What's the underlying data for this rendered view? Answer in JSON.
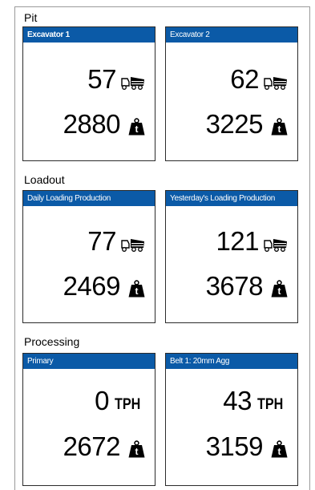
{
  "sections": [
    {
      "title": "Pit",
      "cards": [
        {
          "title": "Excavator 1",
          "bold": true,
          "metric1": {
            "value": "57",
            "icon": "haul-truck-icon"
          },
          "metric2": {
            "value": "2880",
            "icon": "tonne-weight-icon",
            "glyph": "t"
          }
        },
        {
          "title": "Excavator 2",
          "bold": false,
          "metric1": {
            "value": "62",
            "icon": "haul-truck-icon"
          },
          "metric2": {
            "value": "3225",
            "icon": "tonne-weight-icon",
            "glyph": "t"
          }
        }
      ]
    },
    {
      "title": "Loadout",
      "cards": [
        {
          "title": "Daily Loading Production",
          "bold": false,
          "metric1": {
            "value": "77",
            "icon": "haul-truck-icon"
          },
          "metric2": {
            "value": "2469",
            "icon": "tonne-weight-icon",
            "glyph": "t"
          }
        },
        {
          "title": "Yesterday's Loading Production",
          "bold": false,
          "metric1": {
            "value": "121",
            "icon": "haul-truck-icon"
          },
          "metric2": {
            "value": "3678",
            "icon": "tonne-weight-icon",
            "glyph": "t"
          }
        }
      ]
    },
    {
      "title": "Processing",
      "cards": [
        {
          "title": "Primary",
          "bold": false,
          "metric1": {
            "value": "0",
            "unit": "TPH"
          },
          "metric2": {
            "value": "2672",
            "icon": "tonne-weight-icon",
            "glyph": "t"
          }
        },
        {
          "title": "Belt 1: 20mm Agg",
          "bold": false,
          "metric1": {
            "value": "43",
            "unit": "TPH"
          },
          "metric2": {
            "value": "3159",
            "icon": "tonne-weight-icon",
            "glyph": "t"
          }
        }
      ]
    }
  ],
  "colors": {
    "header_bg": "#0b5aa7",
    "header_text": "#ffffff",
    "card_border": "#2b2b2b"
  }
}
